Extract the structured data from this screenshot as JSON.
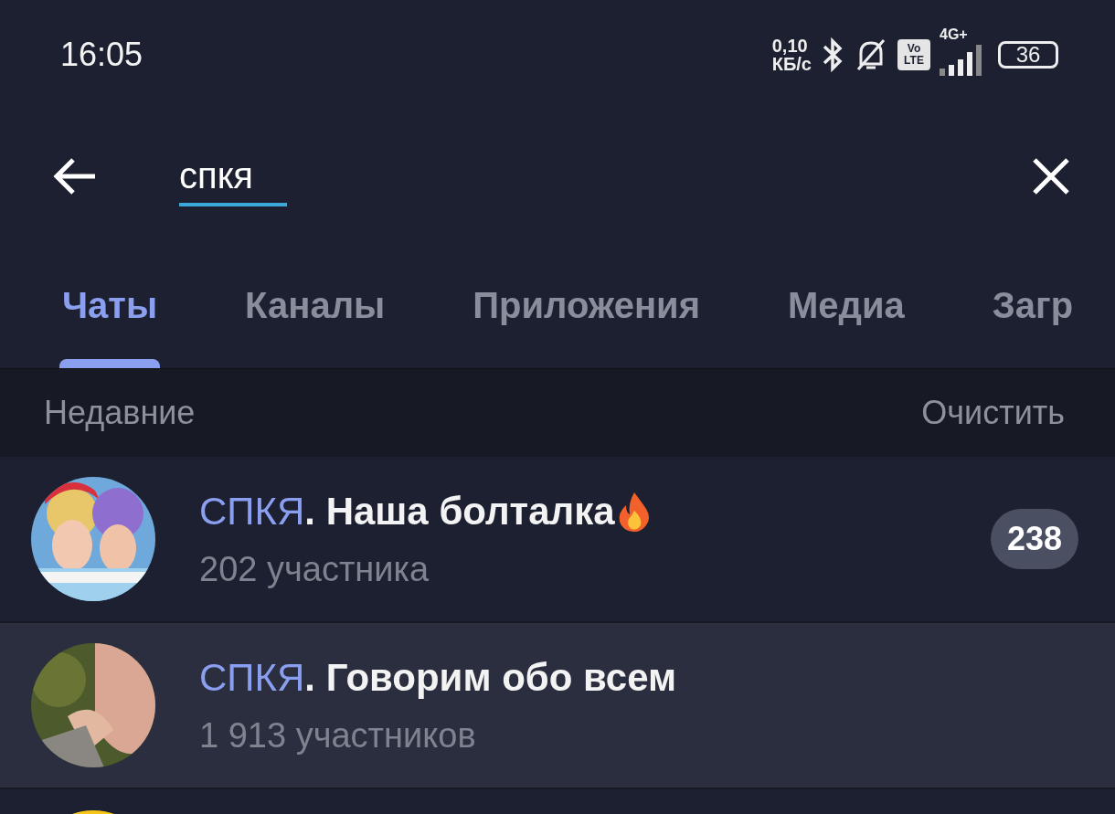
{
  "status_bar": {
    "time": "16:05",
    "net_speed": "0,10",
    "net_unit": "КБ/с",
    "volte": "Vo LTE",
    "network": "4G+",
    "battery": "36"
  },
  "search": {
    "value": "спкя"
  },
  "tabs": [
    {
      "label": "Чаты",
      "selected": true
    },
    {
      "label": "Каналы",
      "selected": false
    },
    {
      "label": "Приложения",
      "selected": false
    },
    {
      "label": "Медиа",
      "selected": false
    },
    {
      "label": "Загр",
      "selected": false
    }
  ],
  "section": {
    "title": "Недавние",
    "action": "Очистить"
  },
  "chats": [
    {
      "match": "СПКЯ",
      "title": ". Наша болталка",
      "emoji": true,
      "subtitle": "202 участника",
      "badge": "238",
      "selected": false
    },
    {
      "match": "СПКЯ",
      "title": ". Говорим обо всем",
      "emoji": false,
      "subtitle": "1 913 участников",
      "selected": true
    }
  ]
}
